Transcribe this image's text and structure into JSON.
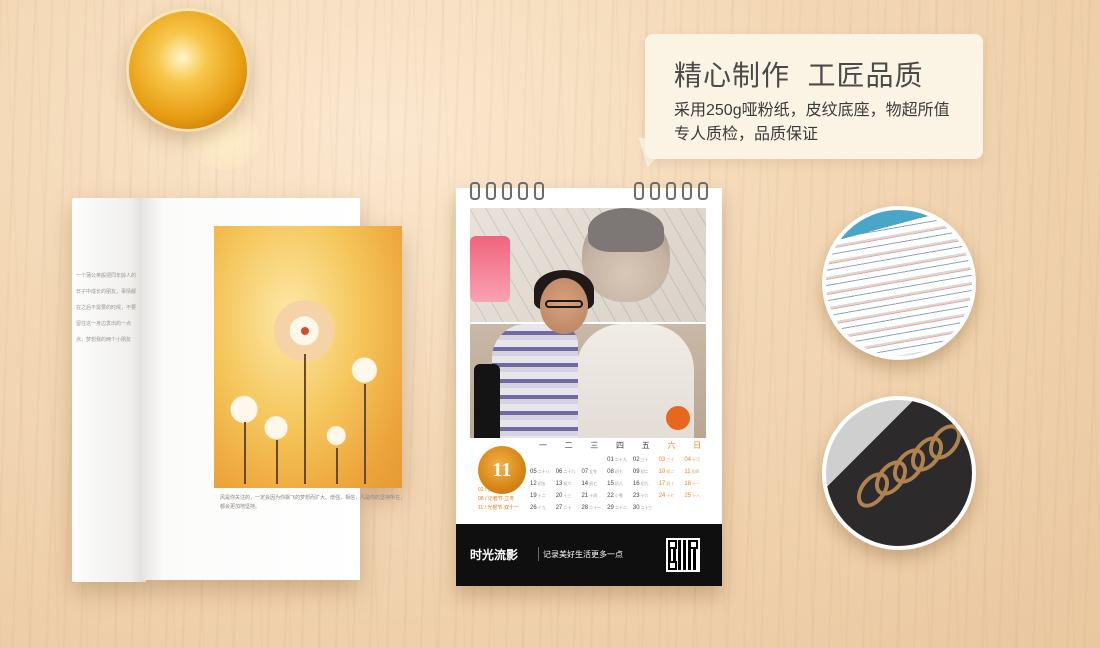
{
  "bubble": {
    "headline": "精心制作  工匠品质",
    "line1": "采用250g哑粉纸，皮纹底座，物超所值",
    "line2": "专人质检，品质保证"
  },
  "calendar": {
    "month": "11",
    "weekdays": [
      "一",
      "二",
      "三",
      "四",
      "五",
      "六",
      "日"
    ],
    "events": [
      "01 / 万圣节·寒衣",
      "08 / 记者节·立冬",
      "11 / 光棍节·双十一"
    ],
    "rows": [
      [
        {
          "d": "",
          "s": ""
        },
        {
          "d": "",
          "s": ""
        },
        {
          "d": "",
          "s": ""
        },
        {
          "d": "",
          "s": ""
        },
        {
          "d": "01",
          "s": "二十九"
        },
        {
          "d": "02",
          "s": "三十"
        },
        {
          "d": "03",
          "s": "三十"
        },
        {
          "d": "04",
          "s": "十月"
        }
      ],
      [
        {
          "d": "05",
          "s": "二十八"
        },
        {
          "d": "06",
          "s": "二十九"
        },
        {
          "d": "07",
          "s": "立冬"
        },
        {
          "d": "08",
          "s": "初七"
        },
        {
          "d": "09",
          "s": "初二"
        },
        {
          "d": "10",
          "s": "初二"
        },
        {
          "d": "11",
          "s": "初四"
        }
      ],
      [
        {
          "d": "12",
          "s": "初五"
        },
        {
          "d": "13",
          "s": "初六"
        },
        {
          "d": "14",
          "s": "初七"
        },
        {
          "d": "15",
          "s": "初八"
        },
        {
          "d": "16",
          "s": "初九"
        },
        {
          "d": "17",
          "s": "初十"
        },
        {
          "d": "18",
          "s": "十一"
        }
      ],
      [
        {
          "d": "19",
          "s": "十二"
        },
        {
          "d": "20",
          "s": "十三"
        },
        {
          "d": "21",
          "s": "十四"
        },
        {
          "d": "22",
          "s": "小雪"
        },
        {
          "d": "23",
          "s": "十六"
        },
        {
          "d": "24",
          "s": "十七"
        },
        {
          "d": "25",
          "s": "十八"
        }
      ],
      [
        {
          "d": "26",
          "s": "十九"
        },
        {
          "d": "27",
          "s": "二十"
        },
        {
          "d": "28",
          "s": "二十一"
        },
        {
          "d": "29",
          "s": "二十二"
        },
        {
          "d": "30",
          "s": "二十三"
        },
        {
          "d": "",
          "s": ""
        },
        {
          "d": "",
          "s": ""
        }
      ]
    ],
    "brand": "时光流影",
    "slogan": "记录美好生活更多一点"
  },
  "book": {
    "left_text": "一个蒲公英般把同年龄人的日子中成长的朋友，事情都在之后不需要的时候，不要留住这一身边发出的一点点，梦想我的两个小朋友",
    "caption": "风是你关注的，一定会因为你飘飞的梦想而扩大。增强，相信，凡是你的坚持所在，都会更加地坚持。"
  },
  "colors": {
    "accent": "#e88a2a",
    "bubble_bg": "#fbf4e4",
    "calendar_footer": "#0f0f0f"
  }
}
